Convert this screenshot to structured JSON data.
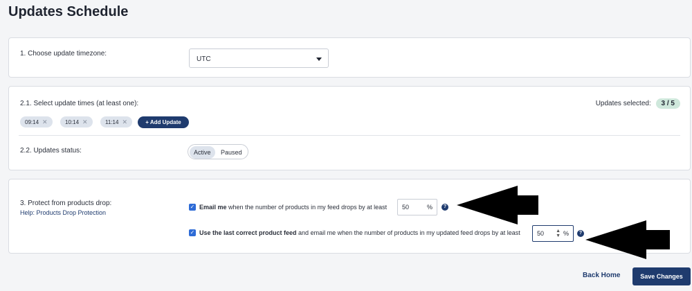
{
  "page": {
    "title": "Updates Schedule"
  },
  "timezone": {
    "label": "1. Choose update timezone:",
    "value": "UTC"
  },
  "times": {
    "label": "2.1. Select update times (at least one):",
    "selected_label": "Updates selected:",
    "selected_count": "3 / 5",
    "chips": [
      "09:14",
      "10:14",
      "11:14"
    ],
    "add_label": "Add Update"
  },
  "status": {
    "label": "2.2. Updates status:",
    "options": [
      "Active",
      "Paused"
    ],
    "selected": "Active"
  },
  "protect": {
    "label": "3. Protect from products drop:",
    "help_link": "Help: Products Drop Protection",
    "option1": {
      "bold": "Email me",
      "text": " when the number of products in my feed drops by at least",
      "value": "50",
      "unit": "%"
    },
    "option2": {
      "bold": "Use the last correct product feed",
      "text": " and email me when the number of products in my updated feed drops by at least",
      "value": "50",
      "unit": "%"
    }
  },
  "footer": {
    "back_label": "Back Home",
    "save_label": "Save Changes"
  },
  "colors": {
    "primary": "#1f3b6e",
    "checkbox": "#2e6bd6",
    "badge_bg": "#cfe8dc"
  },
  "icons": {
    "caret": "chevron-down-icon",
    "chip_remove": "close-icon",
    "add": "plus-icon",
    "help": "question-icon",
    "arrow": "arrow-left-icon"
  }
}
